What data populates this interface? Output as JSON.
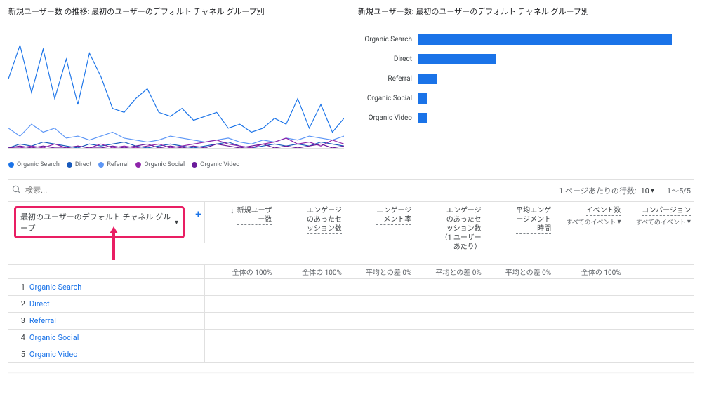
{
  "lineChart": {
    "title": "新規ユーザー数 の推移: 最初のユーザーのデフォルト チャネル グループ別",
    "legend": [
      {
        "label": "Organic Search",
        "color": "#1a73e8"
      },
      {
        "label": "Direct",
        "color": "#185abc"
      },
      {
        "label": "Referral",
        "color": "#5e97f6"
      },
      {
        "label": "Organic Social",
        "color": "#8e24aa"
      },
      {
        "label": "Organic Video",
        "color": "#6a1b9a"
      }
    ]
  },
  "barChart": {
    "title": "新規ユーザー数: 最初のユーザーのデフォルト チャネル グループ別",
    "bars": [
      {
        "label": "Organic Search",
        "pct": 92
      },
      {
        "label": "Direct",
        "pct": 28
      },
      {
        "label": "Referral",
        "pct": 7
      },
      {
        "label": "Organic Social",
        "pct": 3
      },
      {
        "label": "Organic Video",
        "pct": 3
      }
    ]
  },
  "search": {
    "placeholder": "検索..."
  },
  "pagination": {
    "rowsPerPageLabel": "1 ページあたりの行数:",
    "rowsPerPage": "10",
    "range": "1～5/5"
  },
  "dimension": {
    "label": "最初のユーザーのデフォルト チャネル グループ"
  },
  "plusLabel": "+",
  "metrics": [
    {
      "label": "新規ユーザ\nー数",
      "summary": "全体の 100%",
      "hasSort": true
    },
    {
      "label": "エンゲージ\nのあったセ\nッション数",
      "summary": "全体の 100%"
    },
    {
      "label": "エンゲージ\nメント率",
      "summary": "平均との差 0%"
    },
    {
      "label": "エンゲージ\nのあったセ\nッション数\n（1 ユーザー\nあたり）",
      "summary": "平均との差 0%"
    },
    {
      "label": "平均エンゲ\nージメント\n時間",
      "summary": "平均との差 0%"
    },
    {
      "label": "イベント数",
      "sub": "すべてのイベント",
      "summary": "全体の 100%"
    },
    {
      "label": "コンバージョン",
      "sub": "すべてのイベント",
      "summary": ""
    }
  ],
  "rows": [
    {
      "n": "1",
      "label": "Organic Search"
    },
    {
      "n": "2",
      "label": "Direct"
    },
    {
      "n": "3",
      "label": "Referral"
    },
    {
      "n": "4",
      "label": "Organic Social"
    },
    {
      "n": "5",
      "label": "Organic Video"
    }
  ],
  "chart_data": [
    {
      "type": "line",
      "title": "新規ユーザー数 の推移: 最初のユーザーのデフォルト チャネル グループ別",
      "x_points": 30,
      "ylim": [
        0,
        60
      ],
      "series": [
        {
          "name": "Organic Search",
          "color": "#1a73e8",
          "values": [
            35,
            52,
            28,
            50,
            25,
            45,
            22,
            48,
            36,
            20,
            18,
            25,
            30,
            18,
            16,
            20,
            14,
            16,
            18,
            10,
            12,
            8,
            10,
            15,
            12,
            25,
            10,
            22,
            8,
            15
          ]
        },
        {
          "name": "Direct",
          "color": "#5e97f6",
          "values": [
            10,
            6,
            12,
            8,
            10,
            5,
            6,
            4,
            6,
            8,
            5,
            4,
            3,
            4,
            6,
            5,
            4,
            3,
            4,
            5,
            3,
            2,
            4,
            3,
            5,
            4,
            6,
            5,
            4,
            6
          ]
        },
        {
          "name": "Referral",
          "color": "#185abc",
          "values": [
            0,
            2,
            1,
            3,
            2,
            1,
            0,
            2,
            1,
            2,
            3,
            1,
            0,
            1,
            2,
            1,
            0,
            1,
            2,
            3,
            1,
            0,
            1,
            2,
            1,
            2,
            1,
            3,
            2,
            1
          ]
        },
        {
          "name": "Organic Social",
          "color": "#8e24aa",
          "values": [
            0,
            0,
            1,
            0,
            2,
            0,
            1,
            0,
            2,
            0,
            1,
            0,
            1,
            2,
            0,
            1,
            2,
            3,
            4,
            2,
            1,
            0,
            2,
            3,
            5,
            2,
            3,
            1,
            4,
            2
          ]
        },
        {
          "name": "Organic Video",
          "color": "#6a1b9a",
          "values": [
            0,
            1,
            0,
            1,
            0,
            0,
            1,
            0,
            0,
            1,
            0,
            1,
            2,
            0,
            1,
            0,
            1,
            0,
            2,
            1,
            0,
            1,
            2,
            0,
            1,
            0,
            1,
            2,
            0,
            1
          ]
        }
      ]
    },
    {
      "type": "bar",
      "title": "新規ユーザー数: 最初のユーザーのデフォルト チャネル グループ別",
      "categories": [
        "Organic Search",
        "Direct",
        "Referral",
        "Organic Social",
        "Organic Video"
      ],
      "values": [
        92,
        28,
        7,
        3,
        3
      ]
    }
  ]
}
